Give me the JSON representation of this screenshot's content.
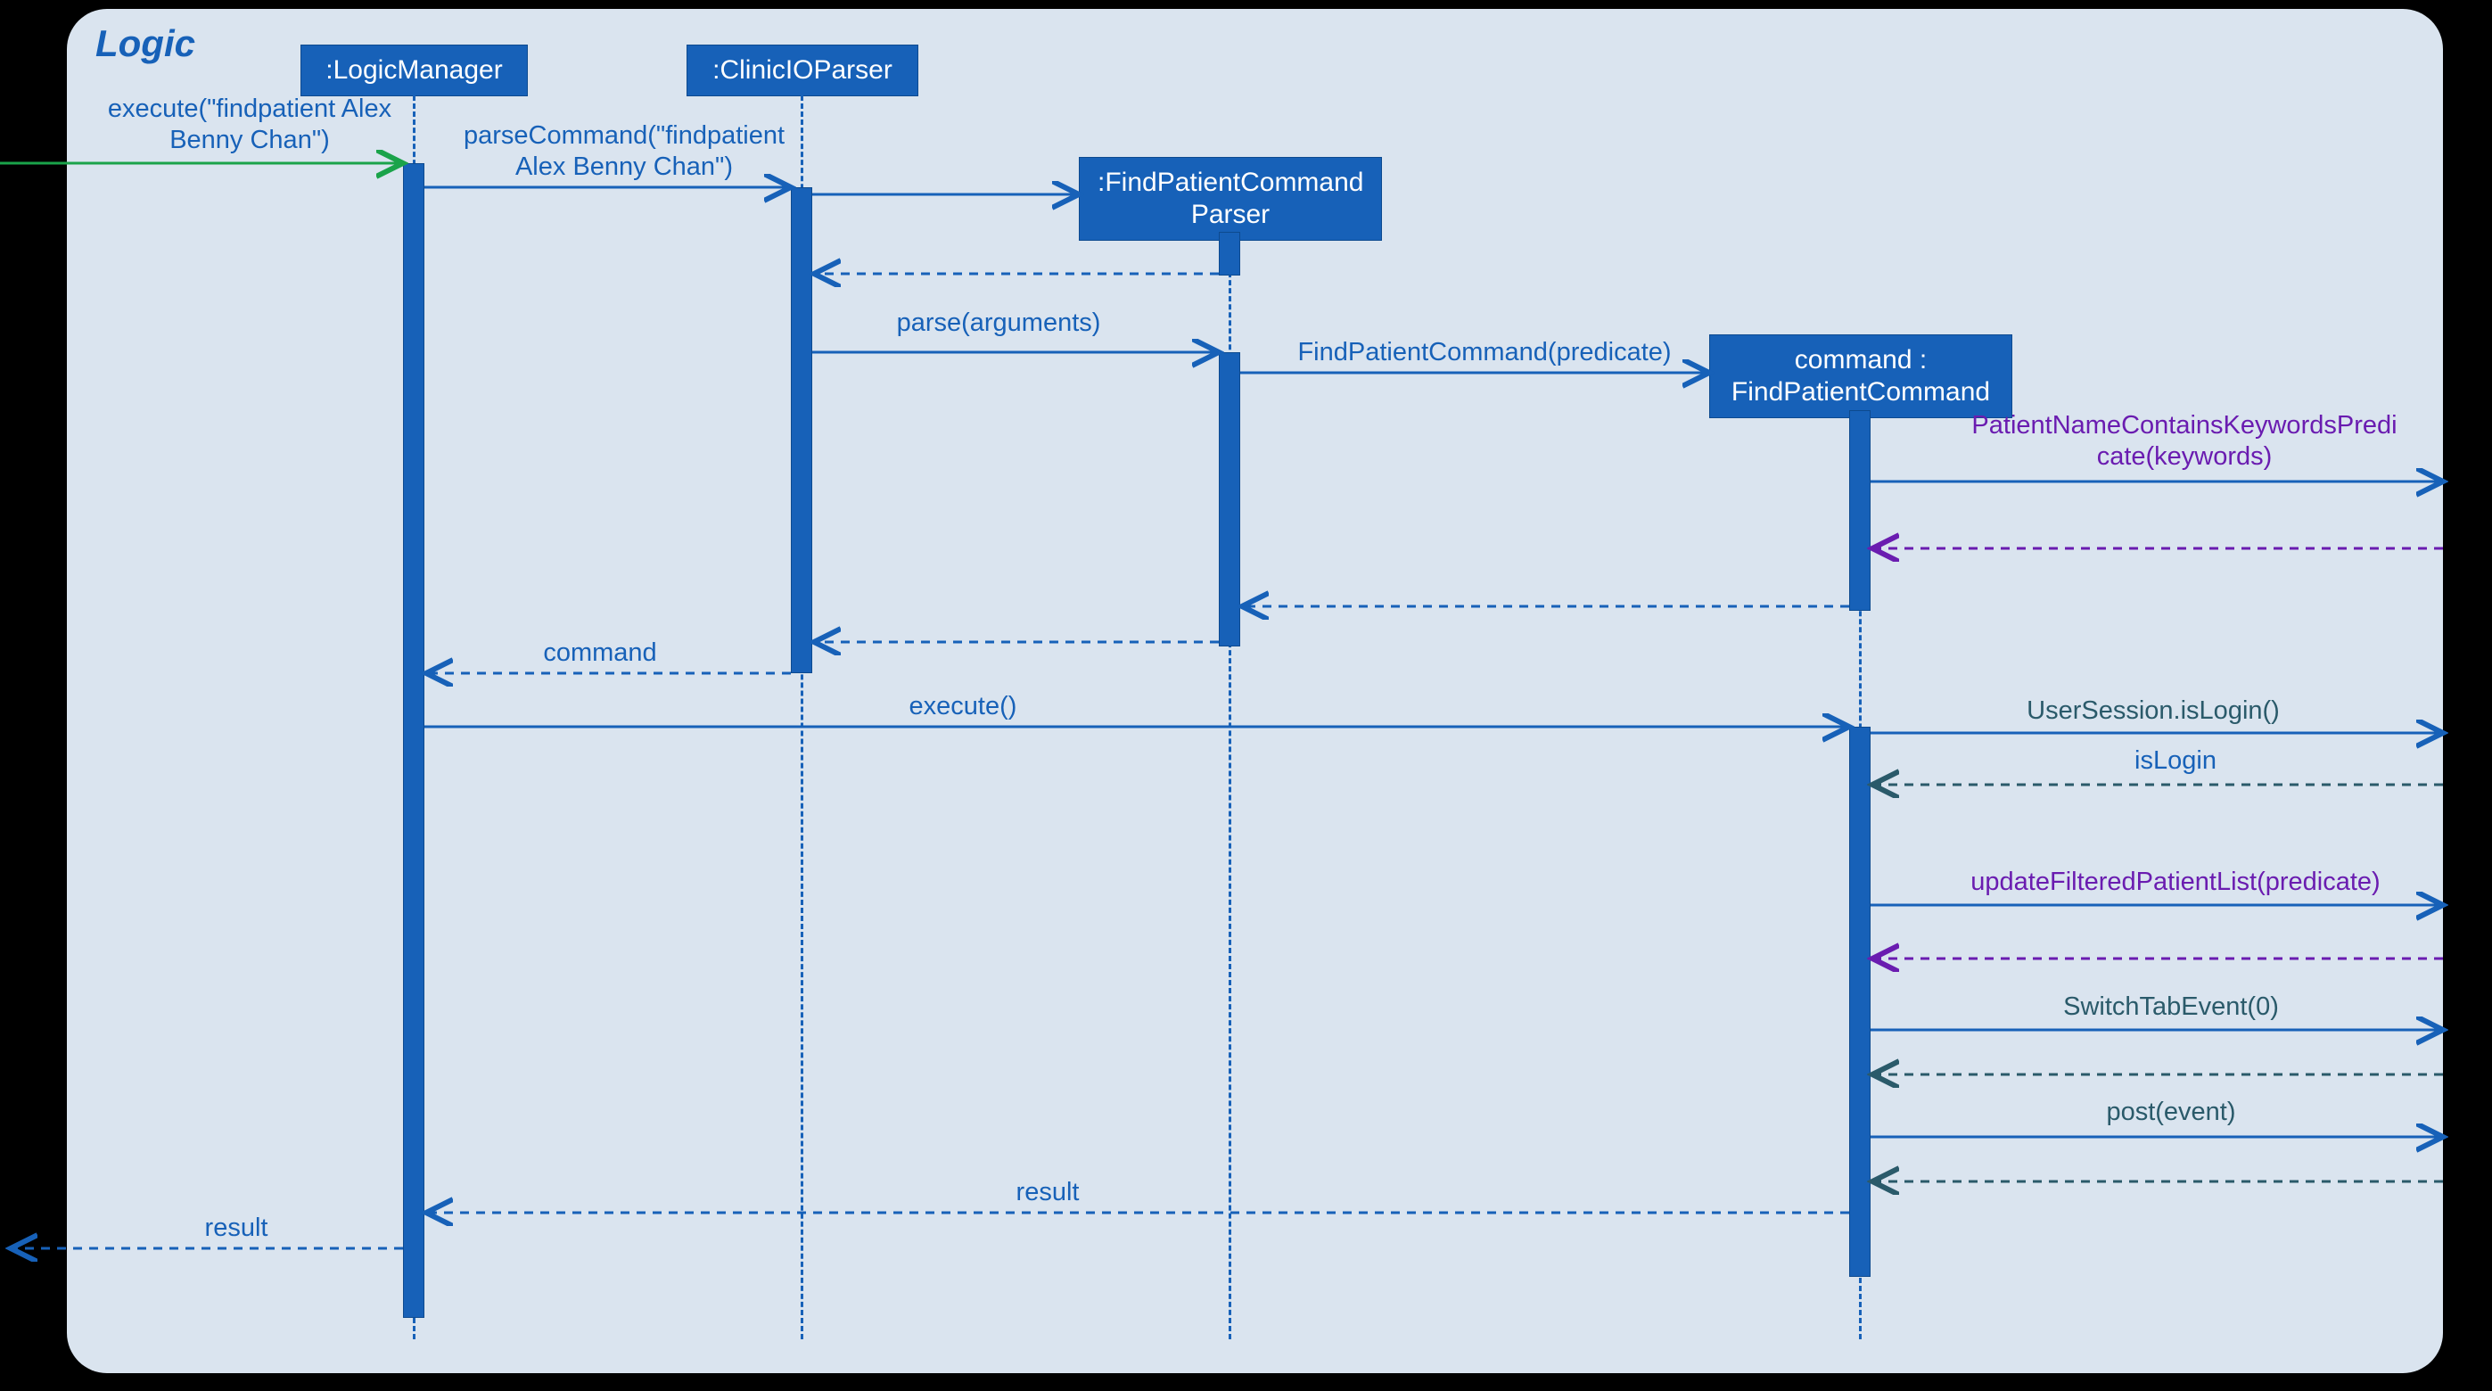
{
  "frame_label": "Logic",
  "participants": {
    "logic_manager": ":LogicManager",
    "clinicio_parser": ":ClinicIOParser",
    "find_patient_command_parser": ":FindPatientCommand\nParser",
    "find_patient_command": "command :\nFindPatientCommand"
  },
  "messages": {
    "execute_findpatient": "execute(\"findpatient Alex\nBenny Chan\")",
    "parse_command": "parseCommand(\"findpatient\nAlex Benny Chan\")",
    "parse_arguments": "parse(arguments)",
    "find_patient_command_predicate": "FindPatientCommand(predicate)",
    "patient_name_contains_keywords": "PatientNameContainsKeywordsPredi\ncate(keywords)",
    "command_return": "command",
    "execute_call": "execute()",
    "user_session_is_login": "UserSession.isLogin()",
    "is_login_return": "isLogin",
    "update_filtered_patient_list": "updateFilteredPatientList(predicate)",
    "switch_tab_event": "SwitchTabEvent(0)",
    "post_event": "post(event)",
    "result_mid": "result",
    "result_final": "result"
  },
  "colors": {
    "blue": "#1761b8",
    "purple": "#6a1cb0",
    "teal": "#2a5a6a",
    "green": "#1aa34a"
  }
}
